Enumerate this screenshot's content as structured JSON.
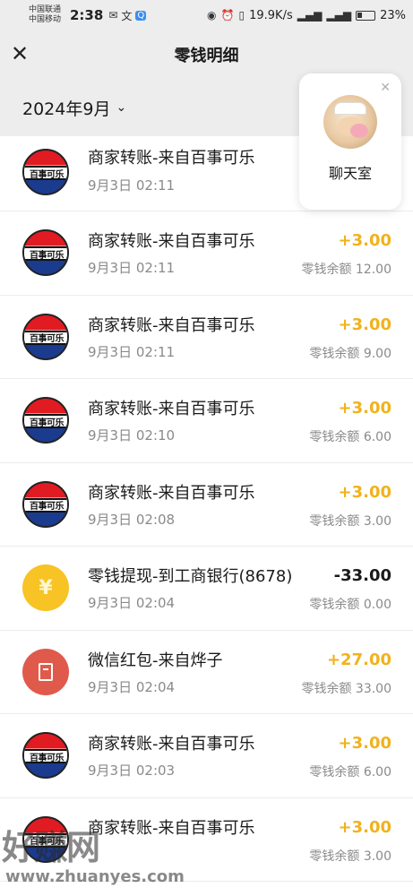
{
  "status_bar": {
    "carrier1": "中国联通",
    "carrier2": "中国移动",
    "time": "2:38",
    "net_speed": "19.9K/s",
    "battery": "23%"
  },
  "header": {
    "title": "零钱明细",
    "close_icon": "close-icon"
  },
  "filter": {
    "month": "2024年9月",
    "chevron_icon": "chevron-down-icon"
  },
  "chat_card": {
    "label": "聊天室",
    "close_icon": "close-icon"
  },
  "transactions": [
    {
      "icon": "pepsi-logo",
      "title": "商家转账-来自百事可乐",
      "time": "9月3日 02:11",
      "amount": "",
      "balance": ""
    },
    {
      "icon": "pepsi-logo",
      "title": "商家转账-来自百事可乐",
      "time": "9月3日 02:11",
      "amount": "+3.00",
      "balance": "零钱余额 12.00"
    },
    {
      "icon": "pepsi-logo",
      "title": "商家转账-来自百事可乐",
      "time": "9月3日 02:11",
      "amount": "+3.00",
      "balance": "零钱余额 9.00"
    },
    {
      "icon": "pepsi-logo",
      "title": "商家转账-来自百事可乐",
      "time": "9月3日 02:10",
      "amount": "+3.00",
      "balance": "零钱余额 6.00"
    },
    {
      "icon": "pepsi-logo",
      "title": "商家转账-来自百事可乐",
      "time": "9月3日 02:08",
      "amount": "+3.00",
      "balance": "零钱余额 3.00"
    },
    {
      "icon": "yuan-coin-icon",
      "title": "零钱提现-到工商银行(8678)",
      "time": "9月3日 02:04",
      "amount": "-33.00",
      "balance": "零钱余额 0.00"
    },
    {
      "icon": "red-packet-icon",
      "title": "微信红包-来自烨子",
      "time": "9月3日 02:04",
      "amount": "+27.00",
      "balance": "零钱余额 33.00"
    },
    {
      "icon": "pepsi-logo",
      "title": "商家转账-来自百事可乐",
      "time": "9月3日 02:03",
      "amount": "+3.00",
      "balance": "零钱余额 6.00"
    },
    {
      "icon": "pepsi-logo",
      "title": "商家转账-来自百事可乐",
      "time": "",
      "amount": "+3.00",
      "balance": "零钱余额 3.00"
    }
  ],
  "pepsi_text": "百事可乐",
  "yuan_symbol": "¥",
  "watermark": {
    "main": "好赚网",
    "url": "www.zhuanyes.com"
  },
  "colors": {
    "income": "#f1b21b",
    "header_bg": "#ededed",
    "pepsi_red": "#e11b22",
    "pepsi_blue": "#1b3b8f",
    "coin": "#f7c325",
    "red_packet": "#e05a4b"
  }
}
